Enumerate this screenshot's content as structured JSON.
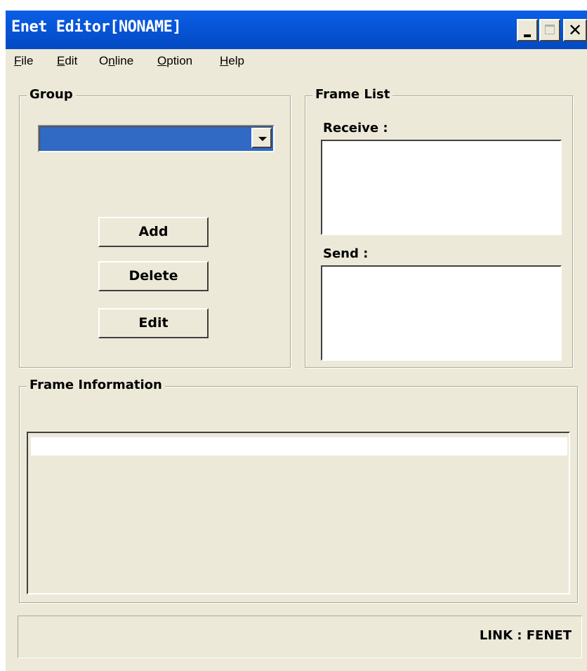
{
  "window": {
    "title": "Enet Editor[NONAME]"
  },
  "menu": [
    {
      "label": "File",
      "accel": "F",
      "rest": "ile"
    },
    {
      "label": "Edit",
      "accel": "E",
      "rest": "dit"
    },
    {
      "label": "Online",
      "pre": "O",
      "accel": "n",
      "rest": "line"
    },
    {
      "label": "Option",
      "accel": "O",
      "rest": "ption"
    },
    {
      "label": "Help",
      "accel": "H",
      "rest": "elp"
    }
  ],
  "group": {
    "title": "Group",
    "selected_value": "",
    "buttons": {
      "add": "Add",
      "delete": "Delete",
      "edit": "Edit"
    }
  },
  "frame_list": {
    "title": "Frame List",
    "receive_label": "Receive :",
    "send_label": "Send :"
  },
  "frame_information": {
    "title": "Frame Information"
  },
  "status": {
    "text": "LINK : FENET"
  },
  "colors": {
    "titlebar": "#0a5fe6",
    "window_bg": "#ece9d8",
    "selection": "#316ac5"
  },
  "icons": {
    "minimize": "minimize-icon",
    "maximize": "maximize-icon",
    "close": "close-icon",
    "dropdown": "chevron-down-icon"
  }
}
